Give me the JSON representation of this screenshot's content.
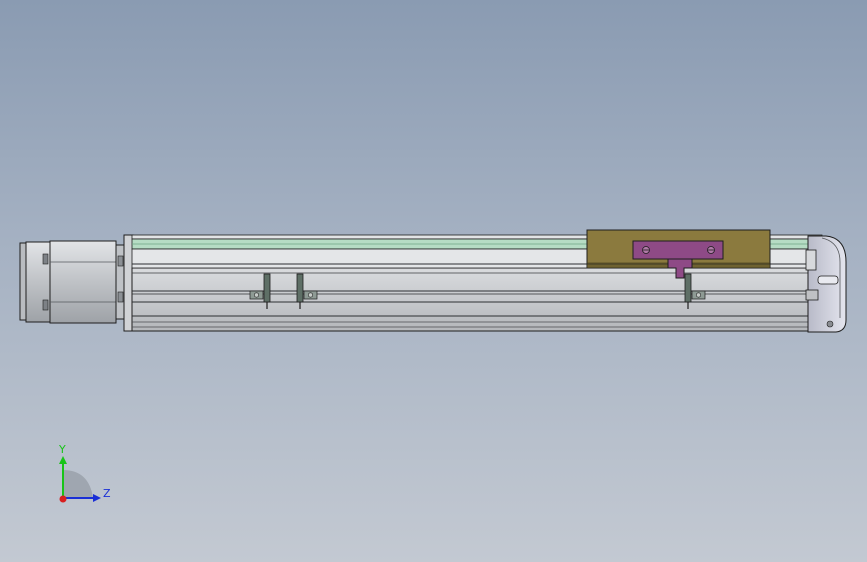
{
  "triad": {
    "y_label": "Y",
    "z_label": "Z",
    "y_color": "#18c418",
    "z_color": "#1a2fd6",
    "origin_color": "#d81e1e"
  },
  "colors": {
    "background_top": "#8a9bb2",
    "background_bottom": "#c3c9d2",
    "rail": "#cfd2d6",
    "guide_rail": "#b6dcc4",
    "carriage": "#8b7a3e",
    "bracket": "#8e4a86",
    "clamp": "#5e6f66",
    "motor": "#c9cbcf",
    "end_cap": "#c7c8d6"
  }
}
